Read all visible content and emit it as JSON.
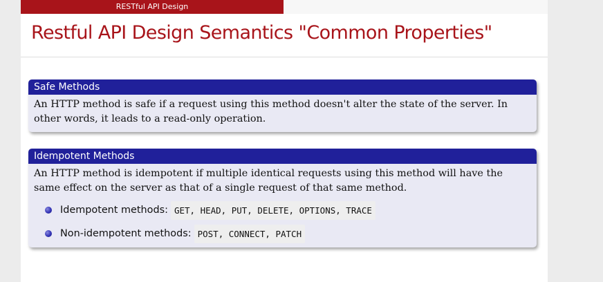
{
  "header": {
    "section": "RESTful API Design"
  },
  "slide": {
    "title": "Restful API Design Semantics \"Common Properties\""
  },
  "blocks": {
    "safe": {
      "title": "Safe Methods",
      "body": "An HTTP method is safe if a request using this method doesn't alter the state of the server. In other words, it leads to a read-only operation."
    },
    "idempotent": {
      "title": "Idempotent Methods",
      "body": "An HTTP method is idempotent if multiple identical requests using this method will have the same effect on the server as that of a single request of that same method.",
      "items": [
        {
          "label": "Idempotent methods:",
          "code": "GET, HEAD, PUT, DELETE, OPTIONS, TRACE"
        },
        {
          "label": "Non-idempotent methods:",
          "code": "POST, CONNECT, PATCH"
        }
      ]
    }
  },
  "colors": {
    "accent_red": "#a8141a",
    "block_title_blue": "#20209a",
    "block_body_bg": "#e9e9f4"
  }
}
